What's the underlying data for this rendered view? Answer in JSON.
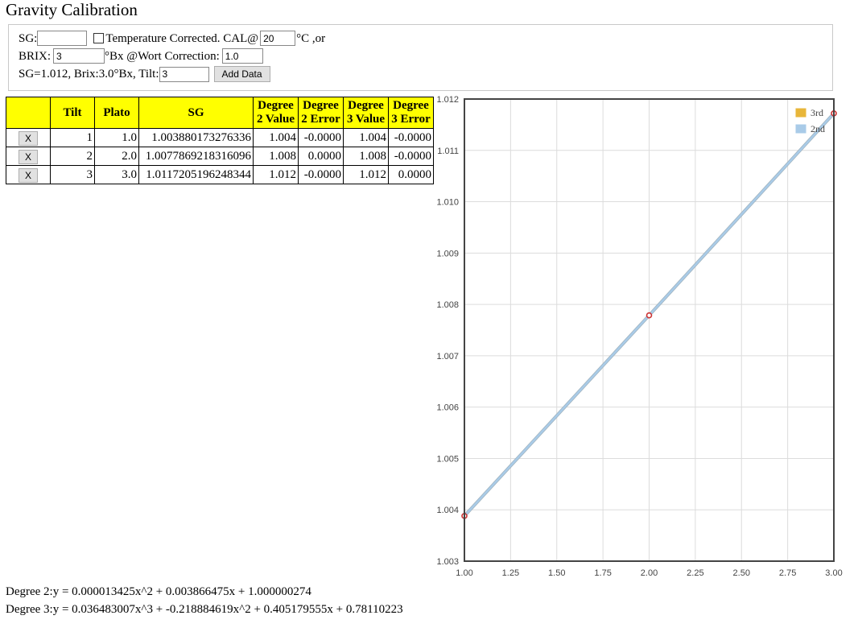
{
  "page": {
    "title": "Gravity Calibration"
  },
  "form": {
    "sg_label": "SG:",
    "sg_value": "",
    "temp_corrected_label": "Temperature Corrected. CAL@",
    "temp_corrected_checked": false,
    "cal_temp_value": "20",
    "cal_unit_label": "°C ,or",
    "brix_label": "BRIX:",
    "brix_value": "3",
    "brix_unit_label": "°Bx @Wort Correction:",
    "wort_correction_value": "1.0",
    "reading_label": "SG=1.012, Brix:3.0°Bx, Tilt:",
    "tilt_value": "3",
    "add_data_label": "Add Data"
  },
  "table": {
    "headers": [
      "",
      "Tilt",
      "Plato",
      "SG",
      "Degree 2 Value",
      "Degree 2 Error",
      "Degree 3 Value",
      "Degree 3 Error"
    ],
    "delete_label": "X",
    "rows": [
      {
        "tilt": "1",
        "plato": "1.0",
        "sg": "1.003880173276336",
        "d2v": "1.004",
        "d2e": "-0.0000",
        "d3v": "1.004",
        "d3e": "-0.0000"
      },
      {
        "tilt": "2",
        "plato": "2.0",
        "sg": "1.0077869218316096",
        "d2v": "1.008",
        "d2e": "0.0000",
        "d3v": "1.008",
        "d3e": "-0.0000"
      },
      {
        "tilt": "3",
        "plato": "3.0",
        "sg": "1.0117205196248344",
        "d2v": "1.012",
        "d2e": "-0.0000",
        "d3v": "1.012",
        "d3e": "0.0000"
      }
    ]
  },
  "equations": {
    "degree2": "Degree 2:y = 0.000013425x^2 + 0.003866475x + 1.000000274",
    "degree3": "Degree 3:y = 0.036483007x^3 + -0.218884619x^2 + 0.405179555x + 0.78110223"
  },
  "chart_data": {
    "type": "line",
    "xlim": [
      1.0,
      3.0
    ],
    "ylim": [
      1.003,
      1.012
    ],
    "x_ticks": [
      "1.00",
      "1.25",
      "1.50",
      "1.75",
      "2.00",
      "2.25",
      "2.50",
      "2.75",
      "3.00"
    ],
    "y_ticks": [
      "1.003",
      "1.004",
      "1.005",
      "1.006",
      "1.007",
      "1.008",
      "1.009",
      "1.010",
      "1.011",
      "1.012"
    ],
    "grid": true,
    "legend_position": "top-right",
    "series": [
      {
        "name": "3rd",
        "color": "#e8b63a",
        "x": [
          1,
          2,
          3
        ],
        "y": [
          1.003880173276336,
          1.0077869218316096,
          1.0117205196248344
        ]
      },
      {
        "name": "2nd",
        "color": "#a9cbe8",
        "x": [
          1,
          2,
          3
        ],
        "y": [
          1.003880173276336,
          1.0077869218316096,
          1.0117205196248344
        ]
      }
    ],
    "points": {
      "x": [
        1,
        2,
        3
      ],
      "y": [
        1.003880173276336,
        1.0077869218316096,
        1.0117205196248344
      ],
      "color": "#cc3333"
    }
  }
}
